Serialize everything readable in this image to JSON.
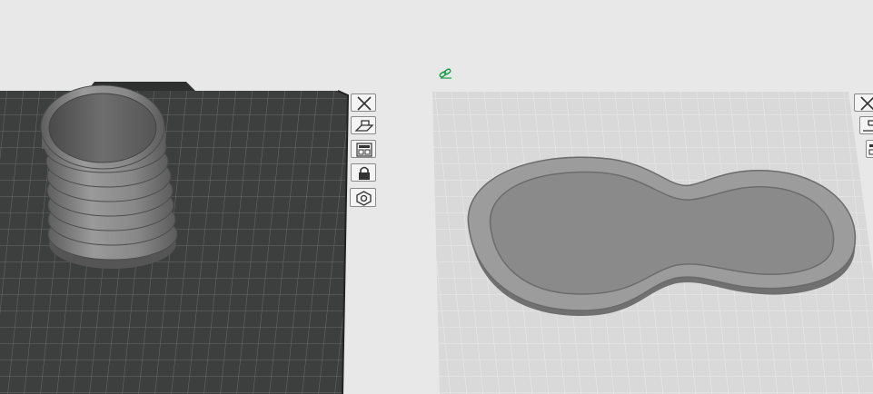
{
  "plates": [
    {
      "id": "plate-1",
      "theme": "dark",
      "object": "ribbed-cup",
      "toolbar": [
        {
          "icon": "close-icon",
          "tooltip": ""
        },
        {
          "icon": "auto-orient-icon",
          "tooltip": ""
        },
        {
          "icon": "arrange-icon",
          "tooltip": ""
        },
        {
          "icon": "lock-icon",
          "tooltip": ""
        },
        {
          "icon": "plate-settings-icon",
          "tooltip": ""
        }
      ]
    },
    {
      "id": "plate-2",
      "theme": "light",
      "object": "peanut-tray",
      "toolbar": [
        {
          "icon": "close-icon",
          "tooltip": ""
        },
        {
          "icon": "auto-orient-icon",
          "tooltip": ""
        },
        {
          "icon": "arrange-icon",
          "tooltip": ""
        }
      ]
    }
  ],
  "colors": {
    "background": "#e8e8e8",
    "dark_plate": "#3d3f3e",
    "light_plate": "#d9d9d9",
    "model": "#8b8b8b",
    "link_icon": "#1e9e4a"
  },
  "link_icon": "link-icon"
}
